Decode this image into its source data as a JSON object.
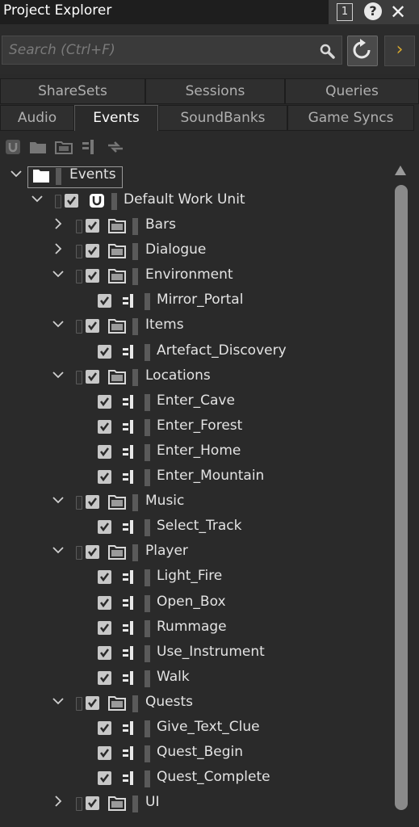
{
  "window": {
    "title": "Project Explorer",
    "pin_label": "1"
  },
  "search": {
    "placeholder": "Search (Ctrl+F)"
  },
  "tabs_row1": [
    {
      "label": "ShareSets"
    },
    {
      "label": "Sessions"
    },
    {
      "label": "Queries"
    }
  ],
  "tabs_row2": [
    {
      "label": "Audio"
    },
    {
      "label": "Events",
      "active": true
    },
    {
      "label": "SoundBanks"
    },
    {
      "label": "Game Syncs"
    }
  ],
  "toolbar_icons": [
    "work-unit-icon",
    "folder-icon",
    "virtual-folder-icon",
    "event-icon",
    "dialogue-event-icon"
  ],
  "tree": {
    "root": {
      "label": "Events"
    },
    "work_unit": {
      "label": "Default Work Unit"
    },
    "nodes": [
      {
        "type": "folder",
        "label": "Bars",
        "expanded": false
      },
      {
        "type": "folder",
        "label": "Dialogue",
        "expanded": false
      },
      {
        "type": "folder",
        "label": "Environment",
        "expanded": true
      },
      {
        "type": "event",
        "label": "Mirror_Portal"
      },
      {
        "type": "folder",
        "label": "Items",
        "expanded": true
      },
      {
        "type": "event",
        "label": "Artefact_Discovery"
      },
      {
        "type": "folder",
        "label": "Locations",
        "expanded": true
      },
      {
        "type": "event",
        "label": "Enter_Cave"
      },
      {
        "type": "event",
        "label": "Enter_Forest"
      },
      {
        "type": "event",
        "label": "Enter_Home"
      },
      {
        "type": "event",
        "label": "Enter_Mountain"
      },
      {
        "type": "folder",
        "label": "Music",
        "expanded": true
      },
      {
        "type": "event",
        "label": "Select_Track"
      },
      {
        "type": "folder",
        "label": "Player",
        "expanded": true
      },
      {
        "type": "event",
        "label": "Light_Fire"
      },
      {
        "type": "event",
        "label": "Open_Box"
      },
      {
        "type": "event",
        "label": "Rummage"
      },
      {
        "type": "event",
        "label": "Use_Instrument"
      },
      {
        "type": "event",
        "label": "Walk"
      },
      {
        "type": "folder",
        "label": "Quests",
        "expanded": true
      },
      {
        "type": "event",
        "label": "Give_Text_Clue"
      },
      {
        "type": "event",
        "label": "Quest_Begin"
      },
      {
        "type": "event",
        "label": "Quest_Complete"
      },
      {
        "type": "folder",
        "label": "UI",
        "expanded": false
      }
    ]
  },
  "colors": {
    "background": "#2a2a2a",
    "text": "#e3e3e3",
    "accent_arrow": "#d6a72d"
  }
}
